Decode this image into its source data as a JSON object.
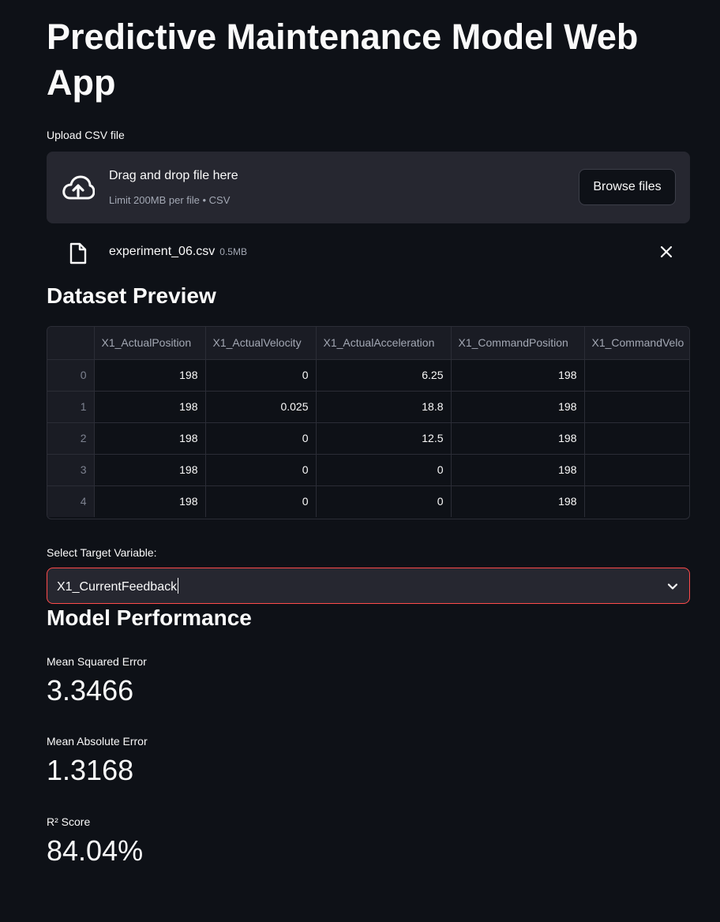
{
  "title": "Predictive Maintenance Model Web App",
  "uploader": {
    "label": "Upload CSV file",
    "drop_text": "Drag and drop file here",
    "limit_text": "Limit 200MB per file • CSV",
    "browse_label": "Browse files",
    "icon": "cloud-upload-icon"
  },
  "file": {
    "name": "experiment_06.csv",
    "size": "0.5MB",
    "icon": "file-icon"
  },
  "dataset_preview": {
    "heading": "Dataset Preview",
    "columns": [
      "",
      "X1_ActualPosition",
      "X1_ActualVelocity",
      "X1_ActualAcceleration",
      "X1_CommandPosition",
      "X1_CommandVelo"
    ],
    "rows": [
      [
        "0",
        "198",
        "0",
        "6.25",
        "198",
        ""
      ],
      [
        "1",
        "198",
        "0.025",
        "18.8",
        "198",
        ""
      ],
      [
        "2",
        "198",
        "0",
        "12.5",
        "198",
        ""
      ],
      [
        "3",
        "198",
        "0",
        "0",
        "198",
        ""
      ],
      [
        "4",
        "198",
        "0",
        "0",
        "198",
        ""
      ]
    ]
  },
  "target_select": {
    "label": "Select Target Variable:",
    "value": "X1_CurrentFeedback"
  },
  "model_performance": {
    "heading": "Model Performance",
    "metrics": [
      {
        "label": "Mean Squared Error",
        "value": "3.3466"
      },
      {
        "label": "Mean Absolute Error",
        "value": "1.3168"
      },
      {
        "label": "R² Score",
        "value": "84.04%"
      }
    ]
  },
  "colors": {
    "background": "#0e1117",
    "panel": "#262730",
    "accent": "#ff4b4b",
    "text": "#fafafa",
    "muted": "#a3a8b4"
  }
}
